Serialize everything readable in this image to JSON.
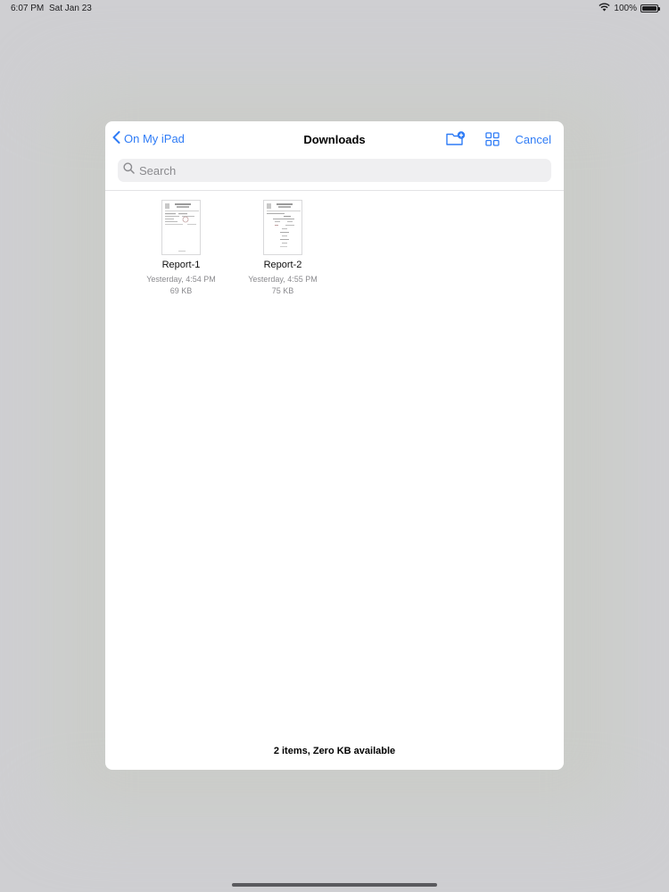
{
  "status_bar": {
    "time": "6:07 PM",
    "date": "Sat Jan 23",
    "battery": "100%",
    "icons": [
      "wifi-icon",
      "battery-icon"
    ]
  },
  "browser": {
    "back_label": "On My iPad",
    "title": "Downloads",
    "cancel_label": "Cancel",
    "search_placeholder": "Search",
    "toolbar_icons": [
      "new-folder-icon",
      "grid-view-icon"
    ],
    "accent_color": "#2f7cf6"
  },
  "files": [
    {
      "name": "Report-1",
      "modified": "Yesterday, 4:54 PM",
      "size": "69 KB"
    },
    {
      "name": "Report-2",
      "modified": "Yesterday, 4:55 PM",
      "size": "75 KB"
    }
  ],
  "footer": {
    "summary": "2 items, Zero KB available"
  }
}
